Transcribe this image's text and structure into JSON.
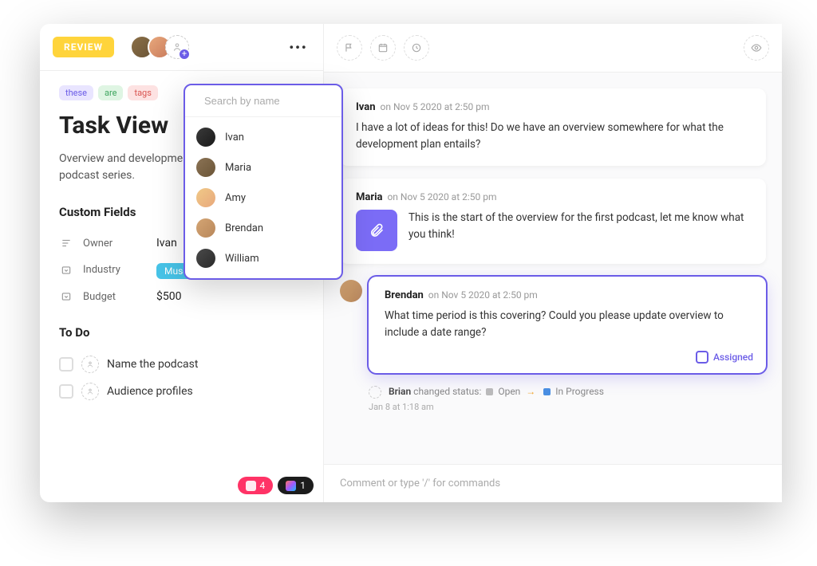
{
  "header": {
    "status_label": "REVIEW"
  },
  "search": {
    "placeholder": "Search by name"
  },
  "people": [
    {
      "name": "Ivan"
    },
    {
      "name": "Maria"
    },
    {
      "name": "Amy"
    },
    {
      "name": "Brendan"
    },
    {
      "name": "William"
    }
  ],
  "tags": {
    "t0": "these",
    "t1": "are",
    "t2": "tags"
  },
  "title": "Task View",
  "description": "Overview and development plan for original podcast series.",
  "custom_fields": {
    "heading": "Custom Fields",
    "owner_label": "Owner",
    "owner_value": "Ivan",
    "industry_label": "Industry",
    "industry_value": "Museum",
    "budget_label": "Budget",
    "budget_value": "$500"
  },
  "todo": {
    "heading": "To Do",
    "items": [
      "Name the podcast",
      "Audience profiles"
    ]
  },
  "integrations": {
    "invision_count": "4",
    "figma_count": "1"
  },
  "comments": [
    {
      "author": "Ivan",
      "meta": "on Nov 5 2020 at 2:50 pm",
      "body": "I have a lot of ideas for this! Do we have an overview somewhere for what the development plan entails?"
    },
    {
      "author": "Maria",
      "meta": "on Nov 5 2020 at 2:50 pm",
      "body": "This is the start of the overview for the first podcast, let me know what you think!"
    },
    {
      "author": "Brendan",
      "meta": "on Nov 5 2020 at 2:50 pm",
      "body": "What time period is this covering? Could you please update overview to include a date range?"
    }
  ],
  "assigned_label": "Assigned",
  "status_change": {
    "author": "Brian",
    "text": "changed status:",
    "from": "Open",
    "to": "In Progress",
    "timestamp": "Jan 8 at 1:18 am"
  },
  "composer": {
    "placeholder": "Comment or type '/' for commands"
  }
}
